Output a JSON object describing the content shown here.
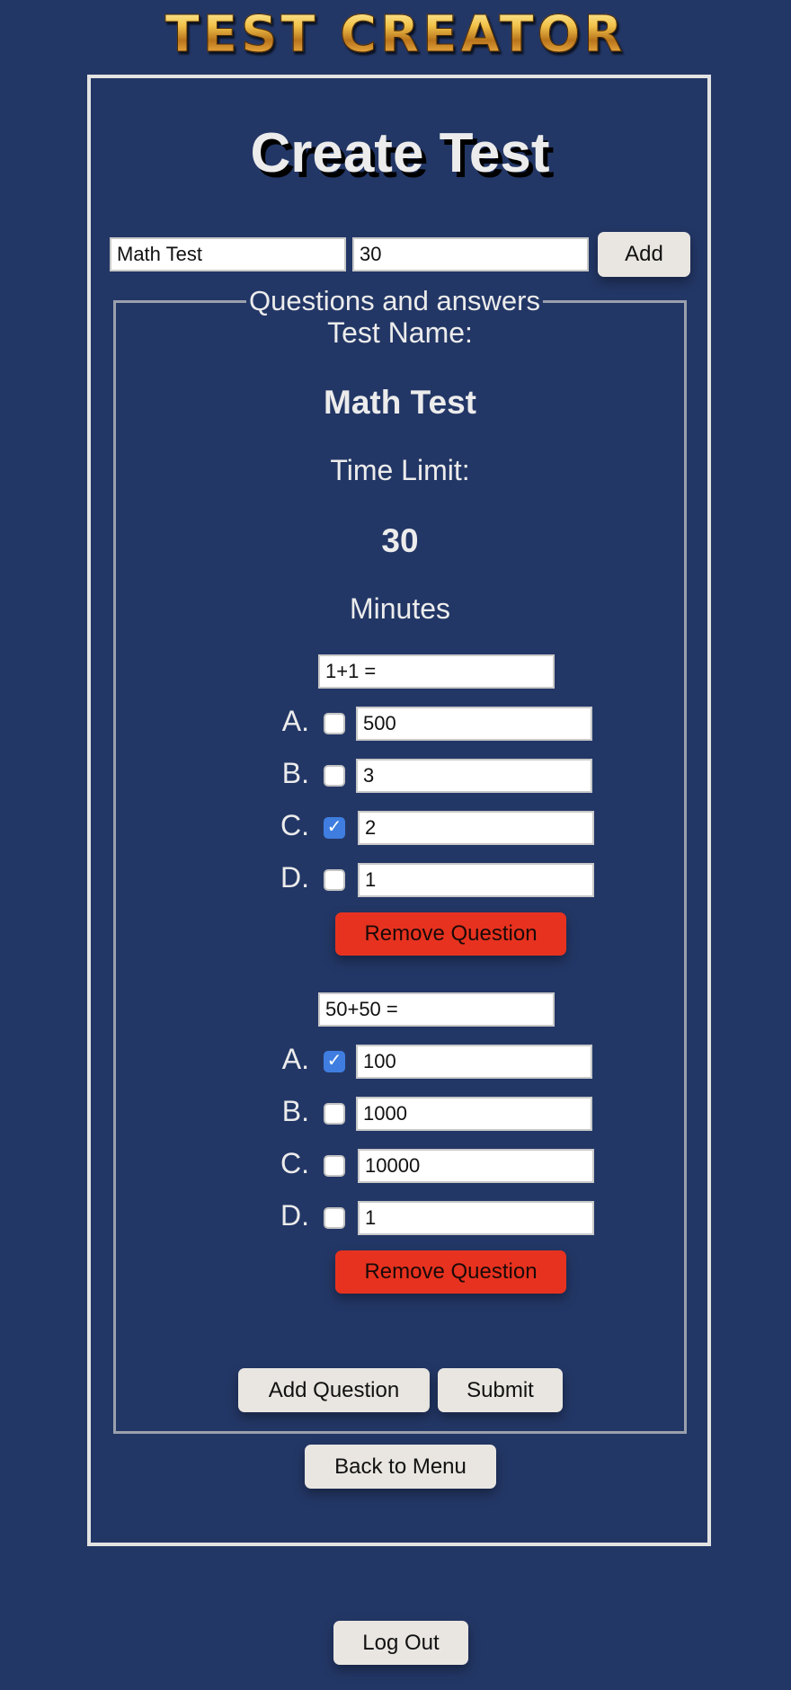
{
  "app": {
    "logo_text": "TEST CREATOR"
  },
  "page": {
    "title": "Create Test"
  },
  "create_form": {
    "name_value": "Math Test",
    "time_value": "30",
    "add_label": "Add"
  },
  "questions_section": {
    "legend": "Questions and answers",
    "test_name_label": "Test Name:",
    "test_name_value": "Math Test",
    "time_limit_label": "Time Limit:",
    "time_limit_value": "30",
    "minutes_label": "Minutes"
  },
  "questions": [
    {
      "text": "1+1 =",
      "answers": [
        {
          "letter": "A.",
          "value": "500",
          "checked": false
        },
        {
          "letter": "B.",
          "value": "3",
          "checked": false
        },
        {
          "letter": "C.",
          "value": "2",
          "checked": true
        },
        {
          "letter": "D.",
          "value": "1",
          "checked": false
        }
      ],
      "remove_label": "Remove Question"
    },
    {
      "text": "50+50 =",
      "answers": [
        {
          "letter": "A.",
          "value": "100",
          "checked": true
        },
        {
          "letter": "B.",
          "value": "1000",
          "checked": false
        },
        {
          "letter": "C.",
          "value": "10000",
          "checked": false
        },
        {
          "letter": "D.",
          "value": "1",
          "checked": false
        }
      ],
      "remove_label": "Remove Question"
    }
  ],
  "actions": {
    "add_question_label": "Add Question",
    "submit_label": "Submit",
    "back_label": "Back to Menu",
    "logout_label": "Log Out"
  },
  "colors": {
    "background": "#233766",
    "remove_button": "#e7321f",
    "checkbox_checked": "#3f7ee0"
  }
}
